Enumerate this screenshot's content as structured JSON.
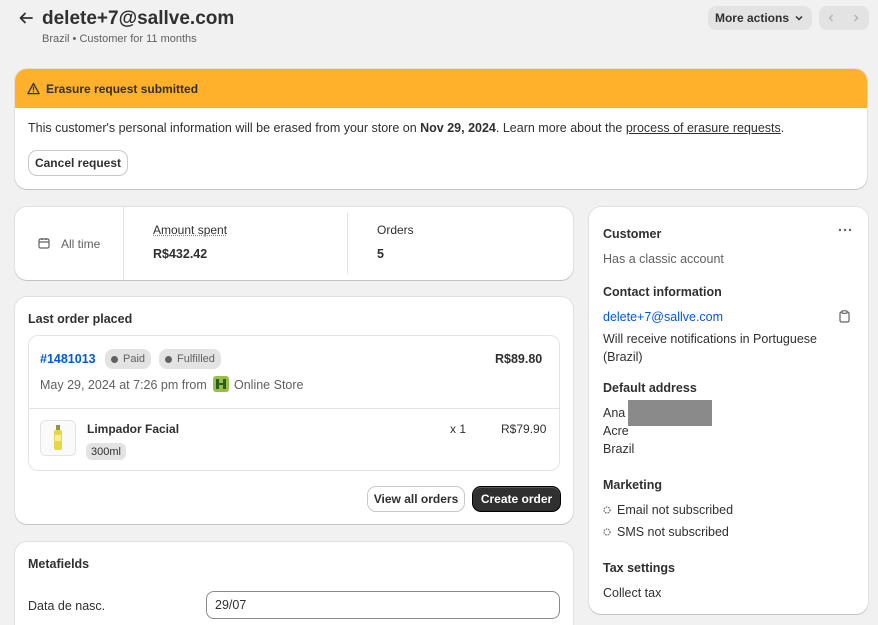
{
  "header": {
    "title": "delete+7@sallve.com",
    "subtitle": "Brazil • Customer for 11 months",
    "more_actions_label": "More actions"
  },
  "banner": {
    "title": "Erasure request submitted",
    "text_before": "This customer's personal information will be erased from your store on ",
    "date": "Nov 29, 2024",
    "text_middle": ". Learn more about the ",
    "link_text": "process of erasure requests",
    "text_after": ".",
    "cancel_label": "Cancel request"
  },
  "stats": {
    "range_label": "All time",
    "amount_label": "Amount spent",
    "amount_value": "R$432.42",
    "orders_label": "Orders",
    "orders_value": "5"
  },
  "last_order": {
    "heading": "Last order placed",
    "order_number": "#1481013",
    "badge_paid": "Paid",
    "badge_fulfilled": "Fulfilled",
    "total": "R$89.80",
    "placed_text": "May 29, 2024 at 7:26 pm from",
    "channel": "Online Store",
    "item_name": "Limpador Facial",
    "item_variant": "300ml",
    "item_qty": "x 1",
    "item_price": "R$79.90",
    "view_all_label": "View all orders",
    "create_label": "Create order"
  },
  "metafields": {
    "heading": "Metafields",
    "field_label": "Data de nasc.",
    "field_value": "29/07"
  },
  "customer": {
    "heading": "Customer",
    "account_text": "Has a classic account",
    "contact_heading": "Contact information",
    "email": "delete+7@sallve.com",
    "notification_text": "Will receive notifications in Portuguese (Brazil)",
    "address_heading": "Default address",
    "address_name": "Ana",
    "address_state": "Acre",
    "address_country": "Brazil",
    "marketing_heading": "Marketing",
    "email_marketing": "Email not subscribed",
    "sms_marketing": "SMS not subscribed",
    "tax_heading": "Tax settings",
    "tax_value": "Collect tax"
  },
  "colors": {
    "banner": "#ffb12b",
    "primary_button": "#303030",
    "link": "#005bd3"
  }
}
